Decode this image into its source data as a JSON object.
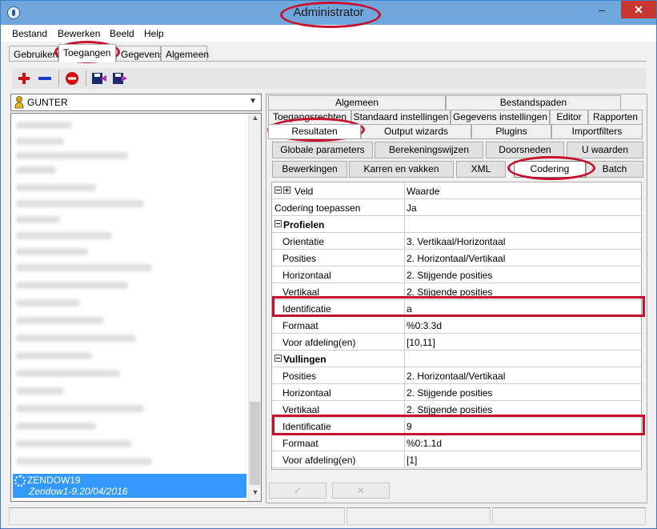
{
  "window": {
    "title": "Administrator"
  },
  "menu": {
    "items": [
      "Bestand",
      "Bewerken",
      "Beeld",
      "Help"
    ]
  },
  "top_tabs": {
    "items": [
      "Gebruikers",
      "Toegangen",
      "Gegevens",
      "Algemeen"
    ],
    "active": "Toegangen"
  },
  "toolbar": {
    "icons": [
      "add-icon",
      "remove-icon",
      "stop-icon",
      "save-left-icon",
      "save-right-icon"
    ]
  },
  "user_combo": {
    "value": "GUNTER"
  },
  "user_list": {
    "selected_line1": "ZENDOW19",
    "selected_line2": "Zendow1-9.20/04/2016"
  },
  "tabs": {
    "row1": [
      "Algemeen",
      "Bestandspaden"
    ],
    "row2": [
      "Toegangsrechten",
      "Standaard instellingen",
      "Gegevens instellingen",
      "Editor",
      "Rapporten"
    ],
    "row3": [
      "Resultaten",
      "Output wizards",
      "Plugins",
      "Importfilters"
    ],
    "active": "Resultaten"
  },
  "sub_buttons": {
    "row1": [
      "Globale parameters",
      "Berekeningswijzen",
      "Doorsneden",
      "U waarden"
    ],
    "row2": [
      "Bewerkingen",
      "Karren en vakken",
      "XML",
      "Codering",
      "Batch"
    ],
    "active": "Codering"
  },
  "grid": {
    "header_veld": "Veld",
    "header_waarde": "Waarde",
    "rows": [
      {
        "type": "item",
        "label": "Codering toepassen",
        "value": "Ja",
        "indent": false
      },
      {
        "type": "section",
        "label": "Profielen"
      },
      {
        "type": "item",
        "label": "Orientatie",
        "value": "3. Vertikaal/Horizontaal",
        "indent": true
      },
      {
        "type": "item",
        "label": "Posities",
        "value": "2. Horizontaal/Vertikaal",
        "indent": true
      },
      {
        "type": "item",
        "label": "Horizontaal",
        "value": "2. Stijgende posities",
        "indent": true
      },
      {
        "type": "item",
        "label": "Vertikaal",
        "value": "2. Stijgende posities",
        "indent": true
      },
      {
        "type": "item",
        "label": "Identificatie",
        "value": "a",
        "indent": true,
        "highlight": true
      },
      {
        "type": "item",
        "label": "Formaat",
        "value": "%0:3.3d",
        "indent": true
      },
      {
        "type": "item",
        "label": "Voor afdeling(en)",
        "value": "[10,11]",
        "indent": true
      },
      {
        "type": "section",
        "label": "Vullingen"
      },
      {
        "type": "item",
        "label": "Posities",
        "value": "2. Horizontaal/Vertikaal",
        "indent": true
      },
      {
        "type": "item",
        "label": "Horizontaal",
        "value": "2. Stijgende posities",
        "indent": true
      },
      {
        "type": "item",
        "label": "Vertikaal",
        "value": "2. Stijgende posities",
        "indent": true
      },
      {
        "type": "item",
        "label": "Identificatie",
        "value": "9",
        "indent": true,
        "highlight": true
      },
      {
        "type": "item",
        "label": "Formaat",
        "value": "%0:1.1d",
        "indent": true
      },
      {
        "type": "item",
        "label": "Voor afdeling(en)",
        "value": "[1]",
        "indent": true
      }
    ]
  },
  "bottom_buttons": {
    "ok_symbol": "✓",
    "cancel_symbol": "✕"
  },
  "colors": {
    "titlebar": "#6fa7dc",
    "highlight": "#c8102e",
    "selection": "#3399ff"
  }
}
